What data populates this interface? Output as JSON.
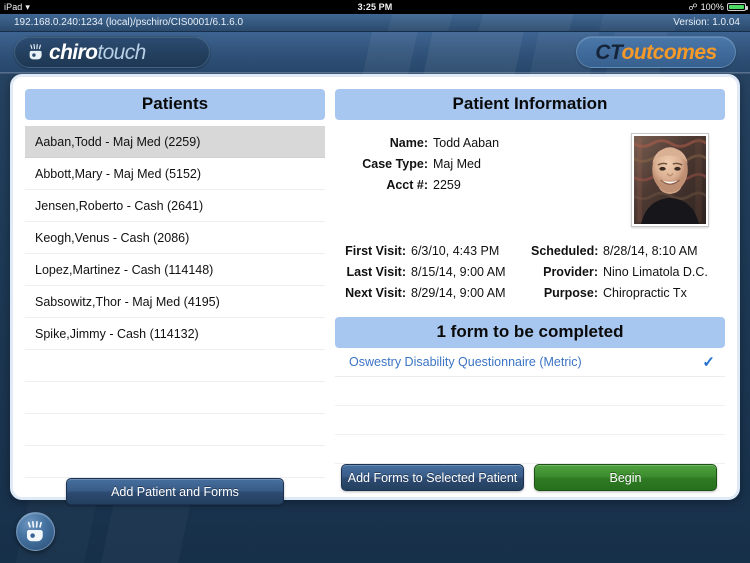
{
  "status_bar": {
    "device": "iPad",
    "wifi_icon": "wifi-icon",
    "time": "3:25 PM",
    "bluetooth_icon": "bluetooth-icon",
    "battery_percent": "100%",
    "battery_icon": "battery-full-charging-icon"
  },
  "app_bar": {
    "connection": "192.168.0.240:1234 (local)/pschiro/CIS0001/6.1.6.0",
    "version": "Version: 1.0.04"
  },
  "brand": {
    "hand_icon": "hand-logo-icon",
    "name_bold": "chiro",
    "name_light": "touch",
    "product_prefix": "CT",
    "product_suffix": "outcomes"
  },
  "patients_panel": {
    "title": "Patients",
    "items": [
      {
        "label": "Aaban,Todd - Maj Med (2259)",
        "selected": true
      },
      {
        "label": "Abbott,Mary - Maj Med (5152)",
        "selected": false
      },
      {
        "label": "Jensen,Roberto - Cash (2641)",
        "selected": false
      },
      {
        "label": "Keogh,Venus - Cash (2086)",
        "selected": false
      },
      {
        "label": "Lopez,Martinez - Cash (114148)",
        "selected": false
      },
      {
        "label": "Sabsowitz,Thor - Maj Med (4195)",
        "selected": false
      },
      {
        "label": "Spike,Jimmy - Cash (114132)",
        "selected": false
      }
    ],
    "empty_rows": 4
  },
  "patient_info": {
    "title": "Patient Information",
    "photo_alt": "patient-photo",
    "fields": [
      {
        "label": "Name:",
        "value": "Todd Aaban"
      },
      {
        "label": "Case Type:",
        "value": "Maj Med"
      },
      {
        "label": "Acct #:",
        "value": "2259"
      }
    ],
    "visits_left": [
      {
        "label": "First Visit:",
        "value": "6/3/10, 4:43 PM"
      },
      {
        "label": "Last Visit:",
        "value": "8/15/14, 9:00 AM"
      },
      {
        "label": "Next Visit:",
        "value": "8/29/14, 9:00 AM"
      }
    ],
    "visits_right": [
      {
        "label": "Scheduled:",
        "value": "8/28/14, 8:10 AM"
      },
      {
        "label": "Provider:",
        "value": "Nino Limatola D.C."
      },
      {
        "label": "Purpose:",
        "value": "Chiropractic Tx"
      }
    ]
  },
  "forms_panel": {
    "title": "1 form to be completed",
    "items": [
      {
        "name": "Oswestry Disability Questionnaire (Metric)",
        "checked": true,
        "check_icon": "checkmark-icon"
      }
    ],
    "empty_rows": 3
  },
  "buttons": {
    "add_patient_and_forms": "Add Patient and Forms",
    "add_forms_to_selected_patient": "Add Forms to Selected Patient",
    "begin": "Begin"
  },
  "fab": {
    "icon": "hand-home-icon"
  },
  "colors": {
    "panel_header": "#a8c7f0",
    "selected_row": "#d8d8d8",
    "link": "#3b74c4",
    "check": "#1f6fd0",
    "begin_green": "#3c8c2e",
    "brand_orange": "#f59a28",
    "chrome_blue": "#35597f"
  }
}
